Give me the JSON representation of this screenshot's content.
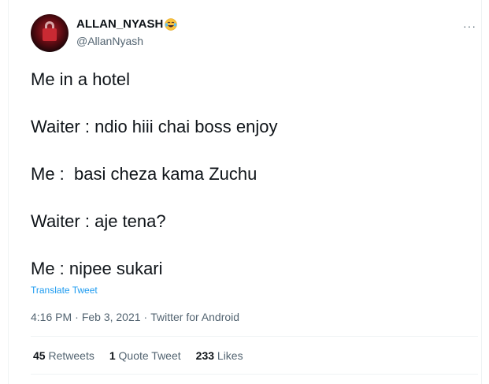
{
  "user": {
    "display_name": "ALLAN_NYASH",
    "handle": "@AllanNyash",
    "name_emoji": "face-with-tears-of-joy-icon"
  },
  "tweet": {
    "lines": [
      "Me in a hotel",
      "Waiter : ndio hiii chai boss enjoy",
      "Me :  basi cheza kama Zuchu",
      "Waiter : aje tena?",
      "Me : nipee sukari"
    ],
    "translate_label": "Translate Tweet",
    "time": "4:16 PM",
    "date": "Feb 3, 2021",
    "source": "Twitter for Android",
    "separator": "·"
  },
  "stats": {
    "retweets_count": "45",
    "retweets_label": "Retweets",
    "quotes_count": "1",
    "quotes_label": "Quote Tweet",
    "likes_count": "233",
    "likes_label": "Likes"
  },
  "colors": {
    "text": "#0f1419",
    "secondary": "#536471",
    "link": "#1d9bf0",
    "border": "#eff3f4"
  }
}
